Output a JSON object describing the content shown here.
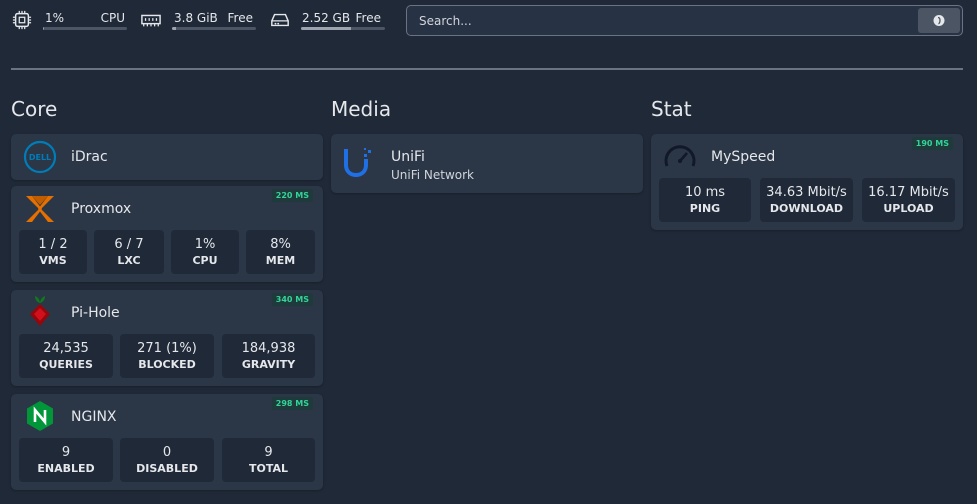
{
  "resources": {
    "cpu": {
      "value": "1%",
      "label": "CPU",
      "usage": 0.01
    },
    "memory": {
      "value": "3.8 GiB",
      "label": "Free",
      "usage": 0.05
    },
    "disk": {
      "value": "2.52 GB",
      "label": "Free",
      "usage": 0.6
    }
  },
  "search": {
    "placeholder": "Search..."
  },
  "columns": {
    "core": "Core",
    "media": "Media",
    "stat": "Stat"
  },
  "services": {
    "idrac": {
      "name": "iDrac",
      "logo_text": "DELL"
    },
    "proxmox": {
      "name": "Proxmox",
      "ms": "220 MS",
      "stats": [
        {
          "value": "1 / 2",
          "label": "VMS"
        },
        {
          "value": "6 / 7",
          "label": "LXC"
        },
        {
          "value": "1%",
          "label": "CPU"
        },
        {
          "value": "8%",
          "label": "MEM"
        }
      ]
    },
    "pihole": {
      "name": "Pi-Hole",
      "ms": "340 MS",
      "stats": [
        {
          "value": "24,535",
          "label": "QUERIES"
        },
        {
          "value": "271 (1%)",
          "label": "BLOCKED"
        },
        {
          "value": "184,938",
          "label": "GRAVITY"
        }
      ]
    },
    "nginx": {
      "name": "NGINX",
      "ms": "298 MS",
      "stats": [
        {
          "value": "9",
          "label": "ENABLED"
        },
        {
          "value": "0",
          "label": "DISABLED"
        },
        {
          "value": "9",
          "label": "TOTAL"
        }
      ]
    },
    "unifi": {
      "name": "UniFi",
      "description": "UniFi Network"
    },
    "myspeed": {
      "name": "MySpeed",
      "ms": "190 MS",
      "stats": [
        {
          "value": "10 ms",
          "label": "PING"
        },
        {
          "value": "34.63 Mbit/s",
          "label": "DOWNLOAD"
        },
        {
          "value": "16.17 Mbit/s",
          "label": "UPLOAD"
        }
      ]
    }
  },
  "colors": {
    "background": "#1f2937",
    "card": "#2b3646",
    "accent_green": "#34d399",
    "proxmox_orange": "#e57000",
    "pihole_red": "#96060c",
    "nginx_green": "#009639",
    "unifi_blue": "#1f6fe5",
    "dell_blue": "#007db8"
  }
}
